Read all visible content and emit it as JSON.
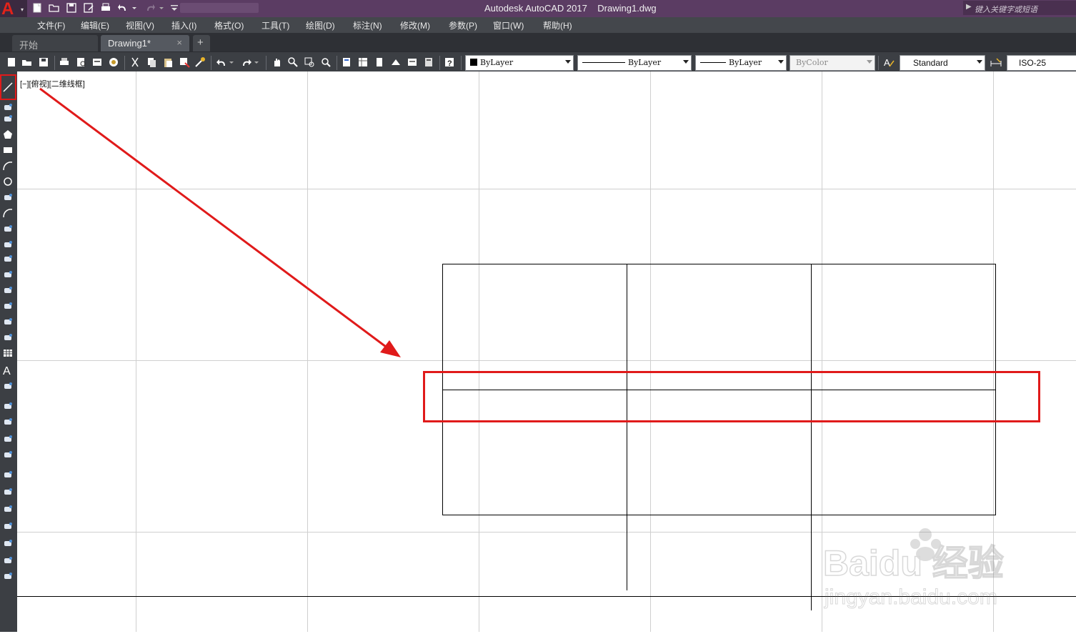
{
  "app": {
    "logo_letter": "A",
    "title": "Autodesk AutoCAD 2017",
    "filename": "Drawing1.dwg",
    "search_placeholder": "键入关键字或短语"
  },
  "menu": [
    "文件(F)",
    "编辑(E)",
    "视图(V)",
    "插入(I)",
    "格式(O)",
    "工具(T)",
    "绘图(D)",
    "标注(N)",
    "修改(M)",
    "参数(P)",
    "窗口(W)",
    "帮助(H)"
  ],
  "tabs": {
    "start": "开始",
    "active": "Drawing1*",
    "close": "×",
    "new": "+"
  },
  "properties": {
    "color": "ByLayer",
    "linetype": "ByLayer",
    "lineweight": "ByLayer",
    "plotstyle": "ByColor",
    "text_style": "Standard",
    "dim_style": "ISO-25"
  },
  "viewport": {
    "label": "[−][俯视][二维线框]"
  },
  "watermark": {
    "brand": "Baidu 经验",
    "url": "jingyan.baidu.com"
  },
  "colors": {
    "highlight": "#e01a1a",
    "title_bar": "#5b3c63",
    "toolbar": "#3c3f44",
    "canvas": "#ffffff"
  },
  "left_tools": [
    "line-icon",
    "polyline-icon",
    "revcloud-icon",
    "polygon-icon",
    "rectangle-icon",
    "arc-icon",
    "circle-icon",
    "cloud-icon",
    "spline-icon",
    "ellipse-icon",
    "ellipse-arc-icon",
    "insert-block-icon",
    "make-block-icon",
    "point-icon",
    "hatch-icon",
    "gradient-icon",
    "region-icon",
    "table-icon",
    "text-icon",
    "add-selected-icon",
    "move-icon",
    "copy-icon",
    "stretch-icon",
    "rotate-icon",
    "mirror-icon",
    "offset-icon",
    "array-icon",
    "trim-icon",
    "extend-icon",
    "break-icon",
    "fillet-icon"
  ]
}
